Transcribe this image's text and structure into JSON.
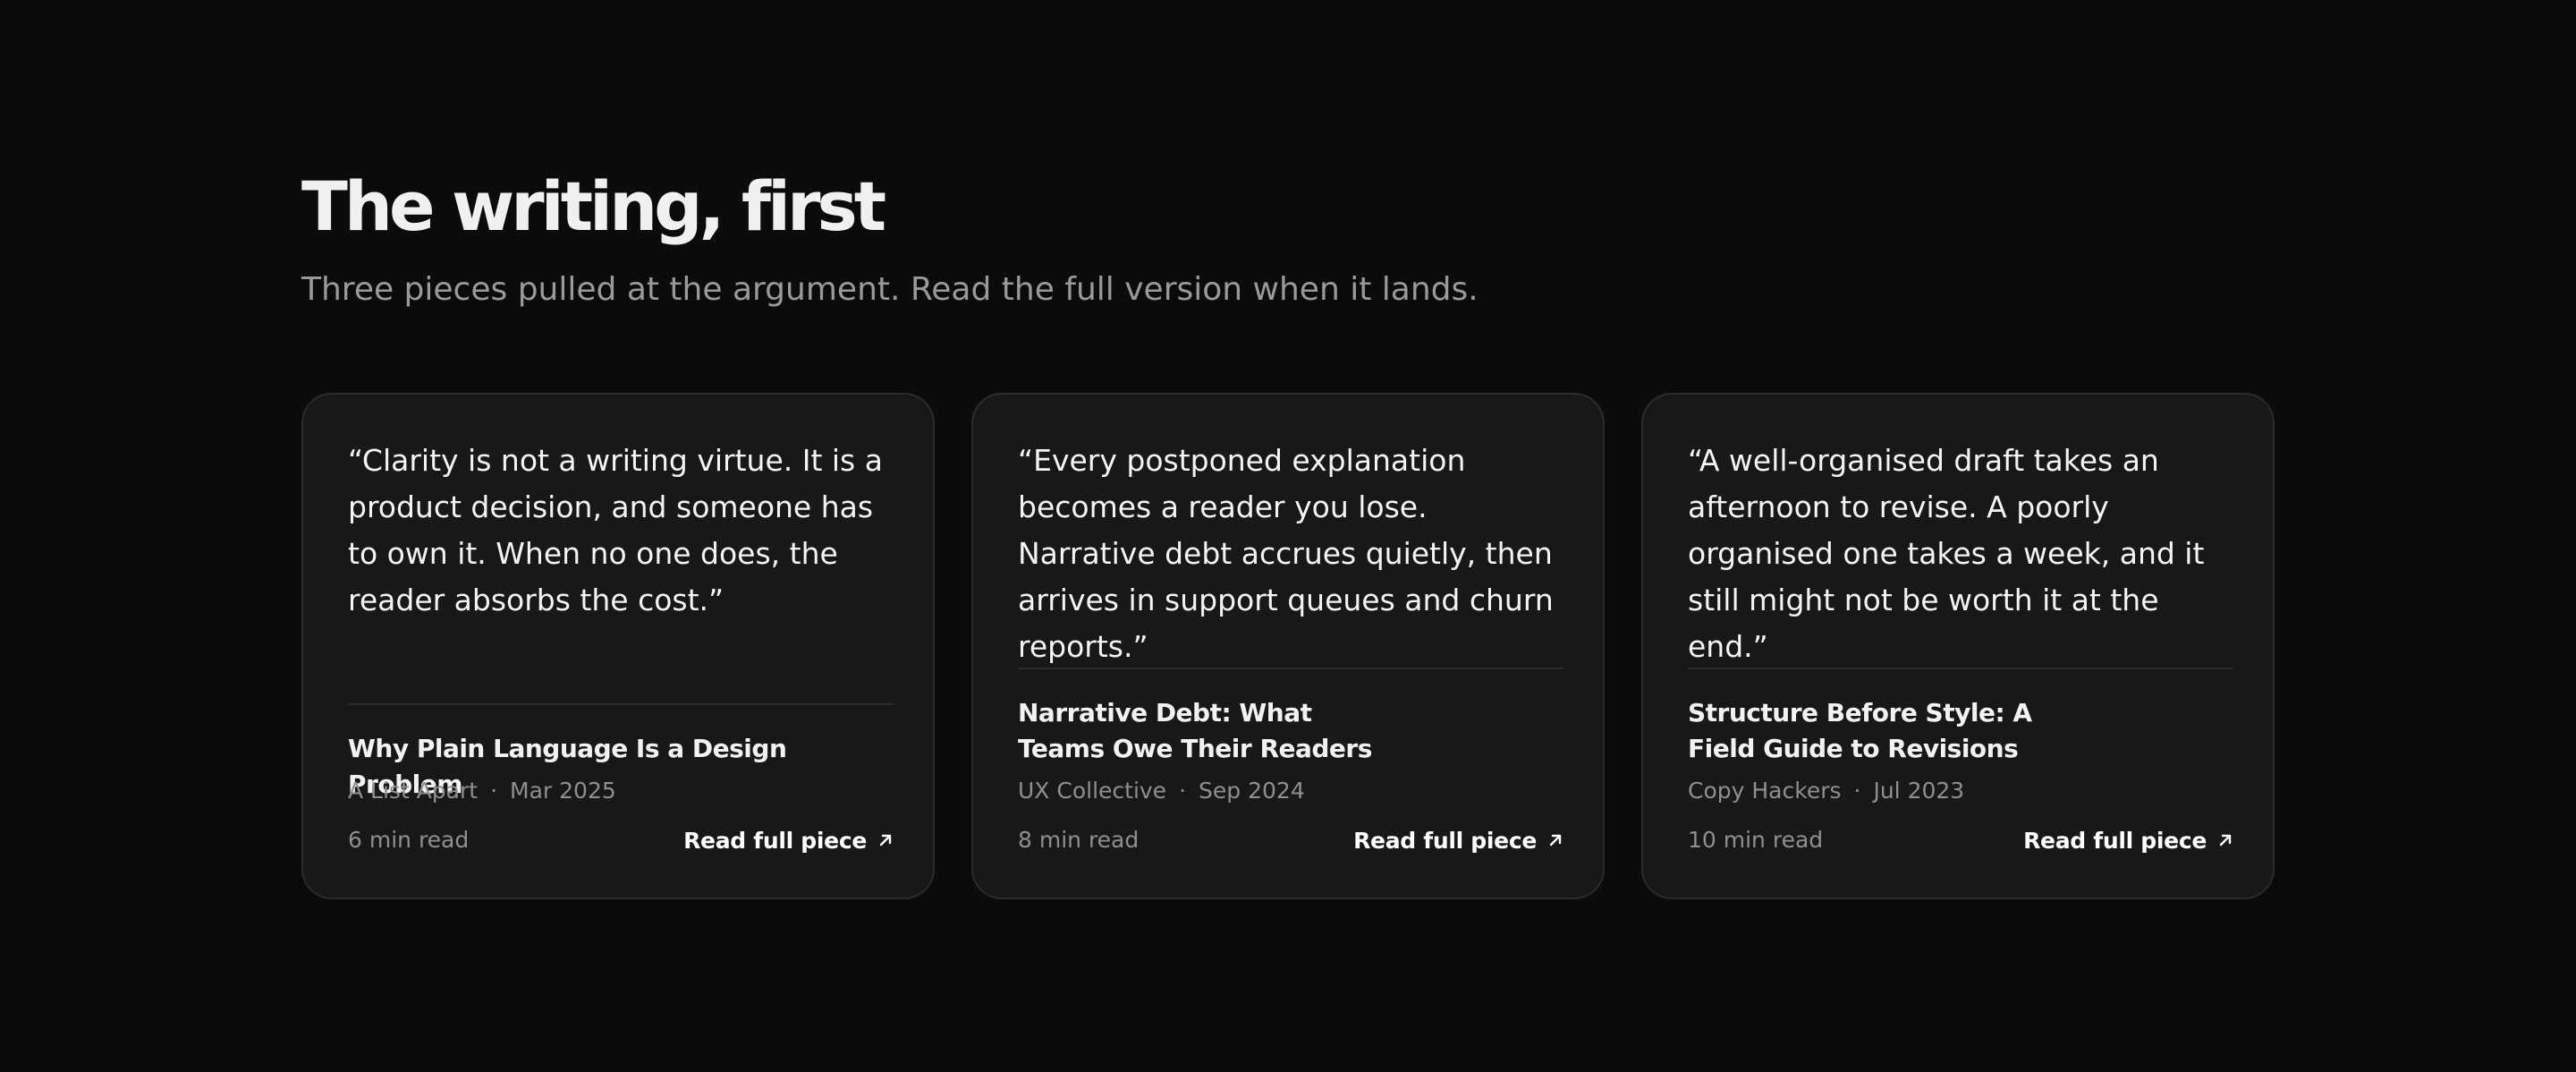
{
  "section": {
    "heading": "The writing, first",
    "subheading": "Three pieces pulled at the argument. Read the full version when it lands."
  },
  "cards": [
    {
      "quote": "“Clarity is not a writing virtue. It is a product decision, and someone has to own it. When no one does, the reader absorbs the cost.”",
      "title": "Why Plain Language Is a Design Problem",
      "publication": "A List Apart",
      "separator": "·",
      "date": "Mar 2025",
      "read_time": "6 min read",
      "link_label": "Read full piece",
      "link_icon": "arrow-up-right-icon"
    },
    {
      "quote": "“Every postponed explanation becomes a reader you lose. Narrative debt accrues quietly, then arrives in support queues and churn reports.”",
      "title": "Narrative Debt: What Teams Owe Their Readers",
      "publication": "UX Collective",
      "separator": "·",
      "date": "Sep 2024",
      "read_time": "8 min read",
      "link_label": "Read full piece",
      "link_icon": "arrow-up-right-icon"
    },
    {
      "quote": "“A well-organised draft takes an afternoon to revise. A poorly organised one takes a week, and it still might not be worth it at the end.”",
      "title": "Structure Before Style: A Field Guide to Revisions",
      "publication": "Copy Hackers",
      "separator": "·",
      "date": "Jul 2023",
      "read_time": "10 min read",
      "link_label": "Read full piece",
      "link_icon": "arrow-up-right-icon"
    }
  ],
  "colors": {
    "background": "#0b0b0b",
    "card_background": "#181818",
    "card_border": "#2b2b2b",
    "heading": "#f0f0f0",
    "muted_text": "#8f8f8f",
    "link": "#ffffff"
  }
}
